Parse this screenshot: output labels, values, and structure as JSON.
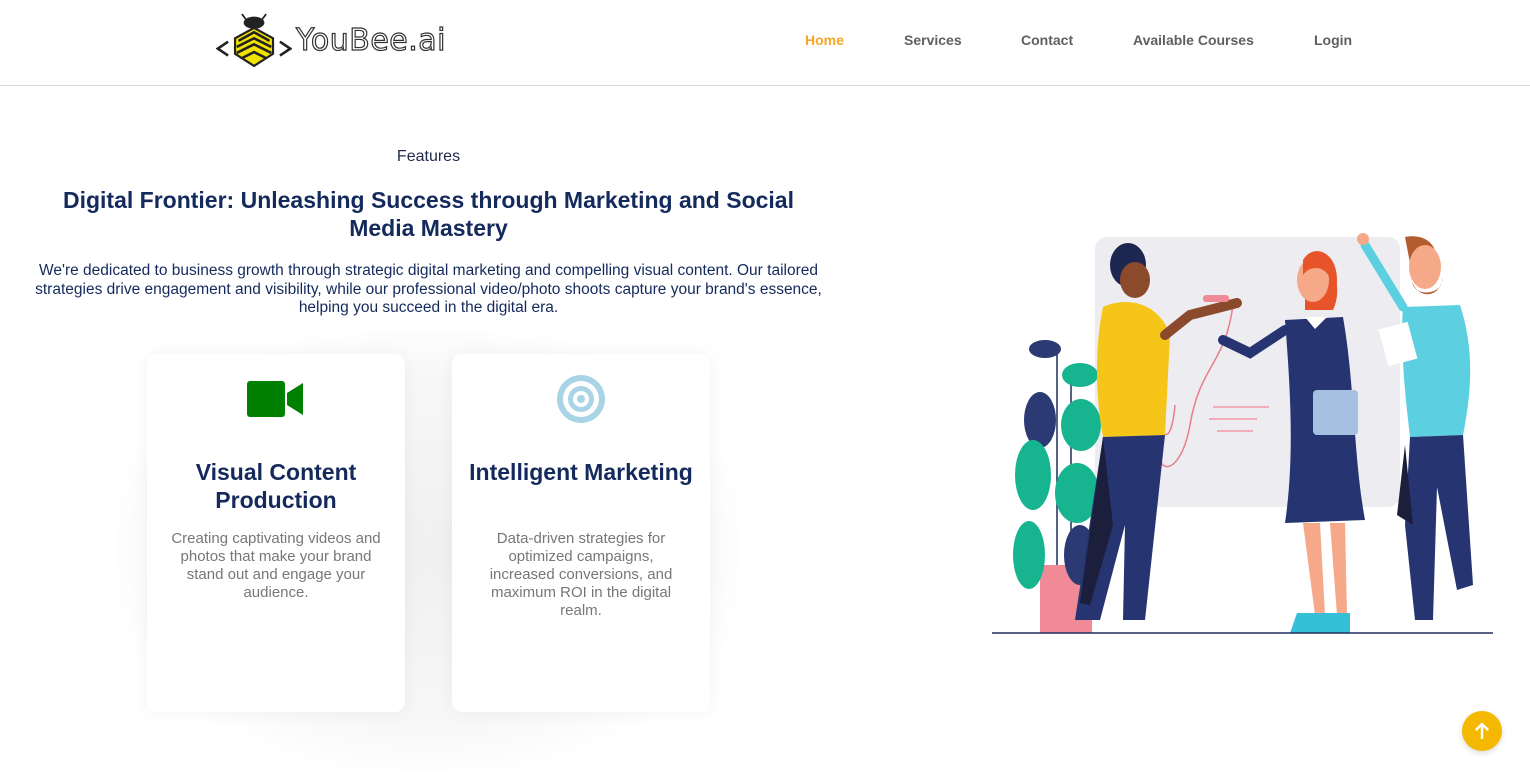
{
  "brand": {
    "name": "YouBee.ai",
    "accent": "#f5a623"
  },
  "nav": {
    "items": [
      {
        "label": "Home",
        "active": true
      },
      {
        "label": "Services",
        "active": false
      },
      {
        "label": "Contact",
        "active": false
      },
      {
        "label": "Available Courses",
        "active": false
      },
      {
        "label": "Login",
        "active": false
      }
    ]
  },
  "features": {
    "eyebrow": "Features",
    "headline": "Digital Frontier: Unleashing Success through Marketing and Social Media Mastery",
    "intro": "We're dedicated to business growth through strategic digital marketing and compelling visual content. Our tailored strategies drive engagement and visibility, while our professional video/photo shoots capture your brand's essence, helping you succeed in the digital era.",
    "cards": [
      {
        "icon": "video-camera-icon",
        "icon_color": "#008000",
        "title": "Visual Content Production",
        "description": "Creating captivating videos and photos that make your brand stand out and engage your audience."
      },
      {
        "icon": "target-icon",
        "icon_color": "#a8d4e6",
        "title": "Intelligent Marketing",
        "description": "Data-driven strategies for optimized campaigns, increased conversions, and maximum ROI in the digital realm."
      }
    ]
  },
  "scroll_top": {
    "icon": "arrow-up-icon",
    "color": "#f5b800"
  }
}
